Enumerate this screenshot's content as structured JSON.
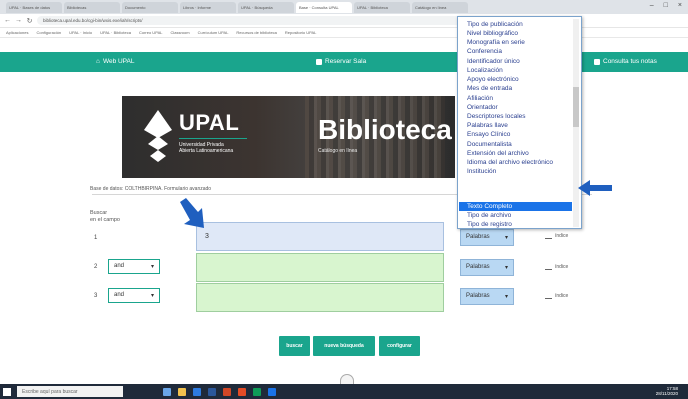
{
  "browser": {
    "tabs": [
      "UPAL · Bases de datos",
      "Bibliotecas",
      "Documento",
      "Libros · Informe",
      "UPAL · Búsqueda",
      "Base · Consulta UPAL",
      "UPAL · Biblioteca",
      "Catálogo en línea"
    ],
    "url": "biblioteca.upal.edu.bo/cgi-bin/wxis.exe/iah/scripts/",
    "bookmarks": [
      "Aplicaciones",
      "Configuración",
      "UPAL · Inicio",
      "UPAL · Biblioteca",
      "Correo UPAL",
      "Classroom",
      "Currículum UPAL",
      "Recursos de biblioteca",
      "Repositorio UPAL"
    ]
  },
  "nav": {
    "web_label": "Web UPAL",
    "reserve_label": "Reservar Sala",
    "query_label": "Consulta tus notas"
  },
  "banner": {
    "logo_title": "UPAL",
    "logo_sub_1": "Universidad Privada",
    "logo_sub_2": "Abierta Latinoamericana",
    "brand": "Biblioteca",
    "brand_sub": "Catálogo en línea"
  },
  "search": {
    "db_line": "Base de datos: COLTHBIRPINA. Formulario avanzado",
    "buscar_label": "Buscar",
    "campo_label": "en el campo",
    "rows": [
      {
        "num": "1",
        "value": "3",
        "field": "Palabras"
      },
      {
        "num": "2",
        "operator": "and",
        "value": "",
        "field": "Palabras"
      },
      {
        "num": "3",
        "operator": "and",
        "value": "",
        "field": "Palabras"
      }
    ],
    "indice_label": "índice"
  },
  "buttons": {
    "search": "buscar",
    "new_search": "nueva búsqueda",
    "config": "configurar"
  },
  "dropdown": {
    "items": [
      "Tipo de publicación",
      "Nivel bibliográfico",
      "Monografía en serie",
      "Conferencia",
      "Identificador único",
      "Localización",
      "Apoyo electrónico",
      "Mes de entrada",
      "Afiliación",
      "Orientador",
      "Descriptores locales",
      "Palabras llave",
      "Ensayo Clínico",
      "Documentalista",
      "Extensión del archivo",
      "Idioma del archivo electrónico",
      "Texto Completo",
      "Tipo de archivo",
      "Tipo de registro",
      "Institución"
    ],
    "selected_index": 16,
    "selected_color": "#1a73e8"
  },
  "taskbar": {
    "search_placeholder": "Escribe aquí para buscar",
    "time": "17:58",
    "date": "28/11/2020"
  },
  "colors": {
    "accent": "#1aa58d",
    "arrow": "#1f5fbf"
  }
}
